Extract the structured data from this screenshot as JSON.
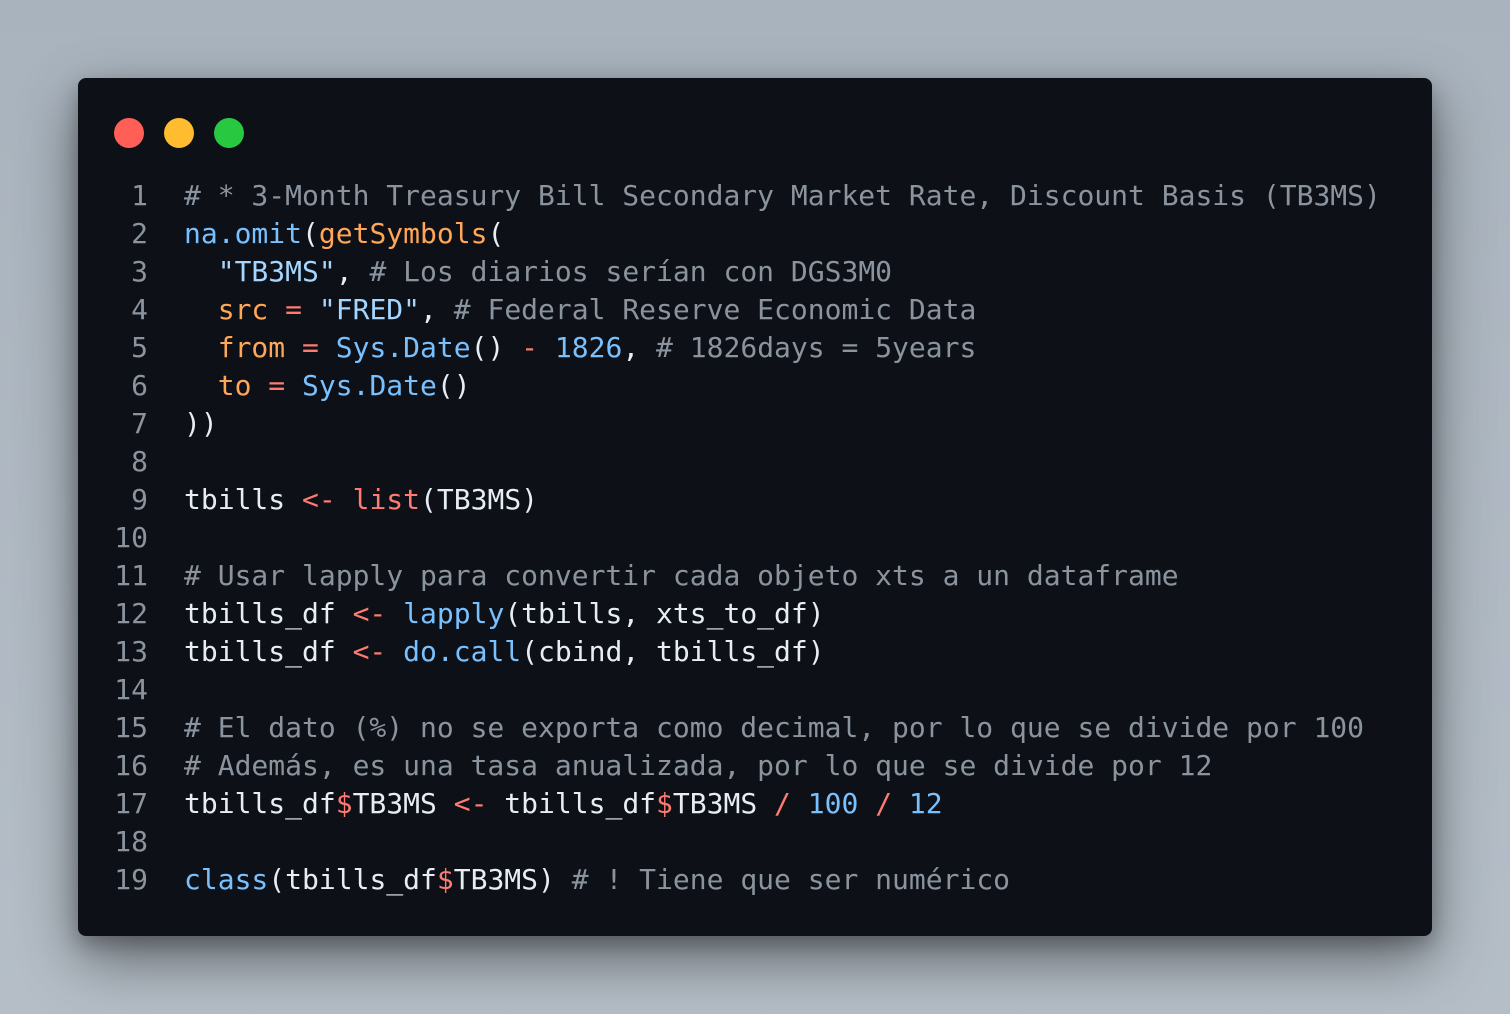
{
  "colors": {
    "background": "#0d1117",
    "comment": "#8b949e",
    "function": "#79c0ff",
    "call": "#ffa657",
    "string": "#a5d6ff",
    "argument": "#ffa657",
    "operator": "#ff7b72",
    "number": "#79c0ff",
    "plain": "#e6edf3",
    "traffic_lights": [
      "#ff5f57",
      "#febc2e",
      "#28c840"
    ]
  },
  "window_controls": [
    "close-dot",
    "minimize-dot",
    "maximize-dot"
  ],
  "code_lines": [
    {
      "n": "1",
      "tokens": [
        [
          "comment",
          "# * 3-Month Treasury Bill Secondary Market Rate, Discount Basis (TB3MS)"
        ]
      ]
    },
    {
      "n": "2",
      "tokens": [
        [
          "func",
          "na.omit"
        ],
        [
          "plain",
          "("
        ],
        [
          "call",
          "getSymbols"
        ],
        [
          "plain",
          "("
        ]
      ]
    },
    {
      "n": "3",
      "tokens": [
        [
          "plain",
          "  "
        ],
        [
          "string",
          "\"TB3MS\""
        ],
        [
          "plain",
          ", "
        ],
        [
          "comment",
          "# Los diarios serían con DGS3M0"
        ]
      ]
    },
    {
      "n": "4",
      "tokens": [
        [
          "plain",
          "  "
        ],
        [
          "arg",
          "src"
        ],
        [
          "plain",
          " "
        ],
        [
          "op",
          "="
        ],
        [
          "plain",
          " "
        ],
        [
          "string",
          "\"FRED\""
        ],
        [
          "plain",
          ", "
        ],
        [
          "comment",
          "# Federal Reserve Economic Data"
        ]
      ]
    },
    {
      "n": "5",
      "tokens": [
        [
          "plain",
          "  "
        ],
        [
          "arg",
          "from"
        ],
        [
          "plain",
          " "
        ],
        [
          "op",
          "="
        ],
        [
          "plain",
          " "
        ],
        [
          "func",
          "Sys.Date"
        ],
        [
          "plain",
          "() "
        ],
        [
          "op",
          "-"
        ],
        [
          "plain",
          " "
        ],
        [
          "num",
          "1826"
        ],
        [
          "plain",
          ", "
        ],
        [
          "comment",
          "# 1826days = 5years"
        ]
      ]
    },
    {
      "n": "6",
      "tokens": [
        [
          "plain",
          "  "
        ],
        [
          "arg",
          "to"
        ],
        [
          "plain",
          " "
        ],
        [
          "op",
          "="
        ],
        [
          "plain",
          " "
        ],
        [
          "func",
          "Sys.Date"
        ],
        [
          "plain",
          "()"
        ]
      ]
    },
    {
      "n": "7",
      "tokens": [
        [
          "plain",
          "))"
        ]
      ]
    },
    {
      "n": "8",
      "tokens": []
    },
    {
      "n": "9",
      "tokens": [
        [
          "plain",
          "tbills "
        ],
        [
          "op",
          "<-"
        ],
        [
          "plain",
          " "
        ],
        [
          "op",
          "list"
        ],
        [
          "plain",
          "(TB3MS)"
        ]
      ]
    },
    {
      "n": "10",
      "tokens": []
    },
    {
      "n": "11",
      "tokens": [
        [
          "comment",
          "# Usar lapply para convertir cada objeto xts a un dataframe"
        ]
      ]
    },
    {
      "n": "12",
      "tokens": [
        [
          "plain",
          "tbills_df "
        ],
        [
          "op",
          "<-"
        ],
        [
          "plain",
          " "
        ],
        [
          "func",
          "lapply"
        ],
        [
          "plain",
          "(tbills, xts_to_df)"
        ]
      ]
    },
    {
      "n": "13",
      "tokens": [
        [
          "plain",
          "tbills_df "
        ],
        [
          "op",
          "<-"
        ],
        [
          "plain",
          " "
        ],
        [
          "func",
          "do.call"
        ],
        [
          "plain",
          "(cbind, tbills_df)"
        ]
      ]
    },
    {
      "n": "14",
      "tokens": []
    },
    {
      "n": "15",
      "tokens": [
        [
          "comment",
          "# El dato (%) no se exporta como decimal, por lo que se divide por 100"
        ]
      ]
    },
    {
      "n": "16",
      "tokens": [
        [
          "comment",
          "# Además, es una tasa anualizada, por lo que se divide por 12"
        ]
      ]
    },
    {
      "n": "17",
      "tokens": [
        [
          "plain",
          "tbills_df"
        ],
        [
          "op",
          "$"
        ],
        [
          "plain",
          "TB3MS "
        ],
        [
          "op",
          "<-"
        ],
        [
          "plain",
          " tbills_df"
        ],
        [
          "op",
          "$"
        ],
        [
          "plain",
          "TB3MS "
        ],
        [
          "op",
          "/"
        ],
        [
          "plain",
          " "
        ],
        [
          "num",
          "100"
        ],
        [
          "plain",
          " "
        ],
        [
          "op",
          "/"
        ],
        [
          "plain",
          " "
        ],
        [
          "num",
          "12"
        ]
      ]
    },
    {
      "n": "18",
      "tokens": []
    },
    {
      "n": "19",
      "tokens": [
        [
          "func",
          "class"
        ],
        [
          "plain",
          "(tbills_df"
        ],
        [
          "op",
          "$"
        ],
        [
          "plain",
          "TB3MS) "
        ],
        [
          "comment",
          "# ! Tiene que ser numérico"
        ]
      ]
    }
  ]
}
